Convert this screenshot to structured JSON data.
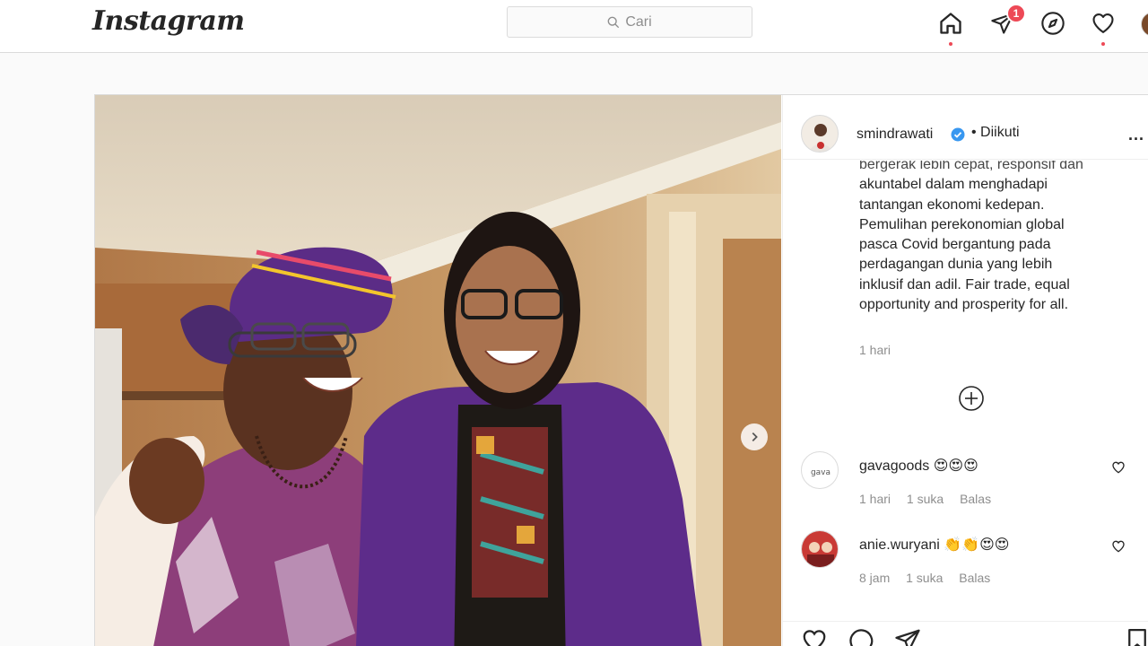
{
  "app": {
    "logo_text": "Instagram"
  },
  "search": {
    "placeholder": "Cari"
  },
  "nav": {
    "direct_badge_count": "1",
    "icons": [
      "home-icon",
      "direct-icon",
      "explore-icon",
      "activity-heart-icon",
      "profile-avatar"
    ]
  },
  "post": {
    "author": {
      "username": "smindrawati",
      "verified": true,
      "follow_status": "• Diikuti"
    },
    "more_label": "...",
    "caption_lines": [
      "bergerak lebih cepat, responsif dan",
      "akuntabel dalam menghadapi",
      "tantangan ekonomi kedepan.",
      "Pemulihan perekonomian global",
      "pasca Covid bergantung pada",
      "perdagangan dunia yang lebih",
      "inklusif dan adil. Fair trade, equal",
      "opportunity and prosperity for all."
    ],
    "caption_time": "1 hari",
    "comments": [
      {
        "username": "gavagoods",
        "text": "😍😍😍",
        "avatar_text": "gava",
        "time": "1 hari",
        "likes": "1 suka",
        "reply": "Balas"
      },
      {
        "username": "anie.wuryani",
        "text": "👏👏😍😍",
        "avatar_text": "",
        "time": "8 jam",
        "likes": "1 suka",
        "reply": "Balas"
      }
    ]
  },
  "colors": {
    "accent_red": "#ed4956",
    "verified_blue": "#3897f0",
    "border": "#dbdbdb",
    "muted_text": "#8e8e8e"
  }
}
